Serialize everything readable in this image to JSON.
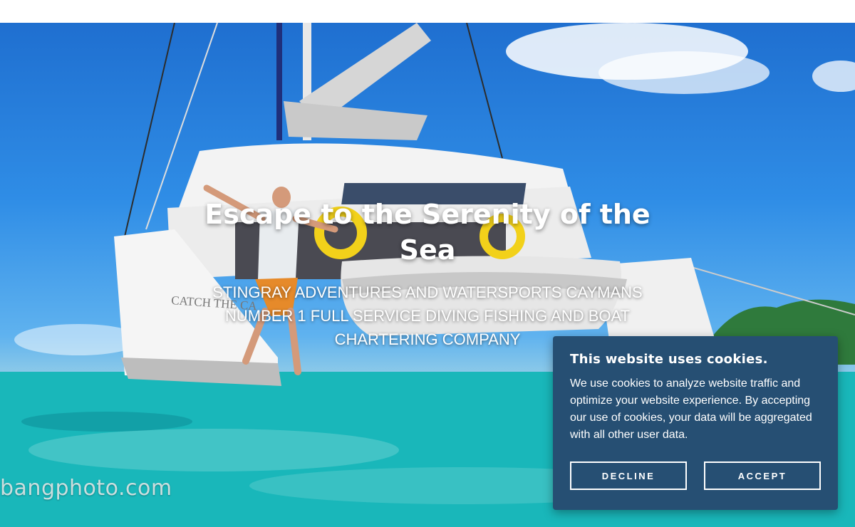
{
  "hero": {
    "title": "Escape to the Serenity of the Sea",
    "subtitle": "Stingray Adventures and Watersports Caymans Number 1 Full Service Diving Fishing and Boat Chartering Company",
    "watermark": "bangphoto.com",
    "boat_name": "CATCH THE CA"
  },
  "cookie_banner": {
    "title": "This website uses cookies.",
    "body": "We use cookies to analyze website traffic and optimize your website experience. By accepting our use of cookies, your data will be aggregated with all other user data.",
    "decline_label": "DECLINE",
    "accept_label": "ACCEPT",
    "background_color": "#264f73"
  },
  "colors": {
    "sky": "#2f8de6",
    "sea": "#18b4b8",
    "text": "#ffffff"
  }
}
